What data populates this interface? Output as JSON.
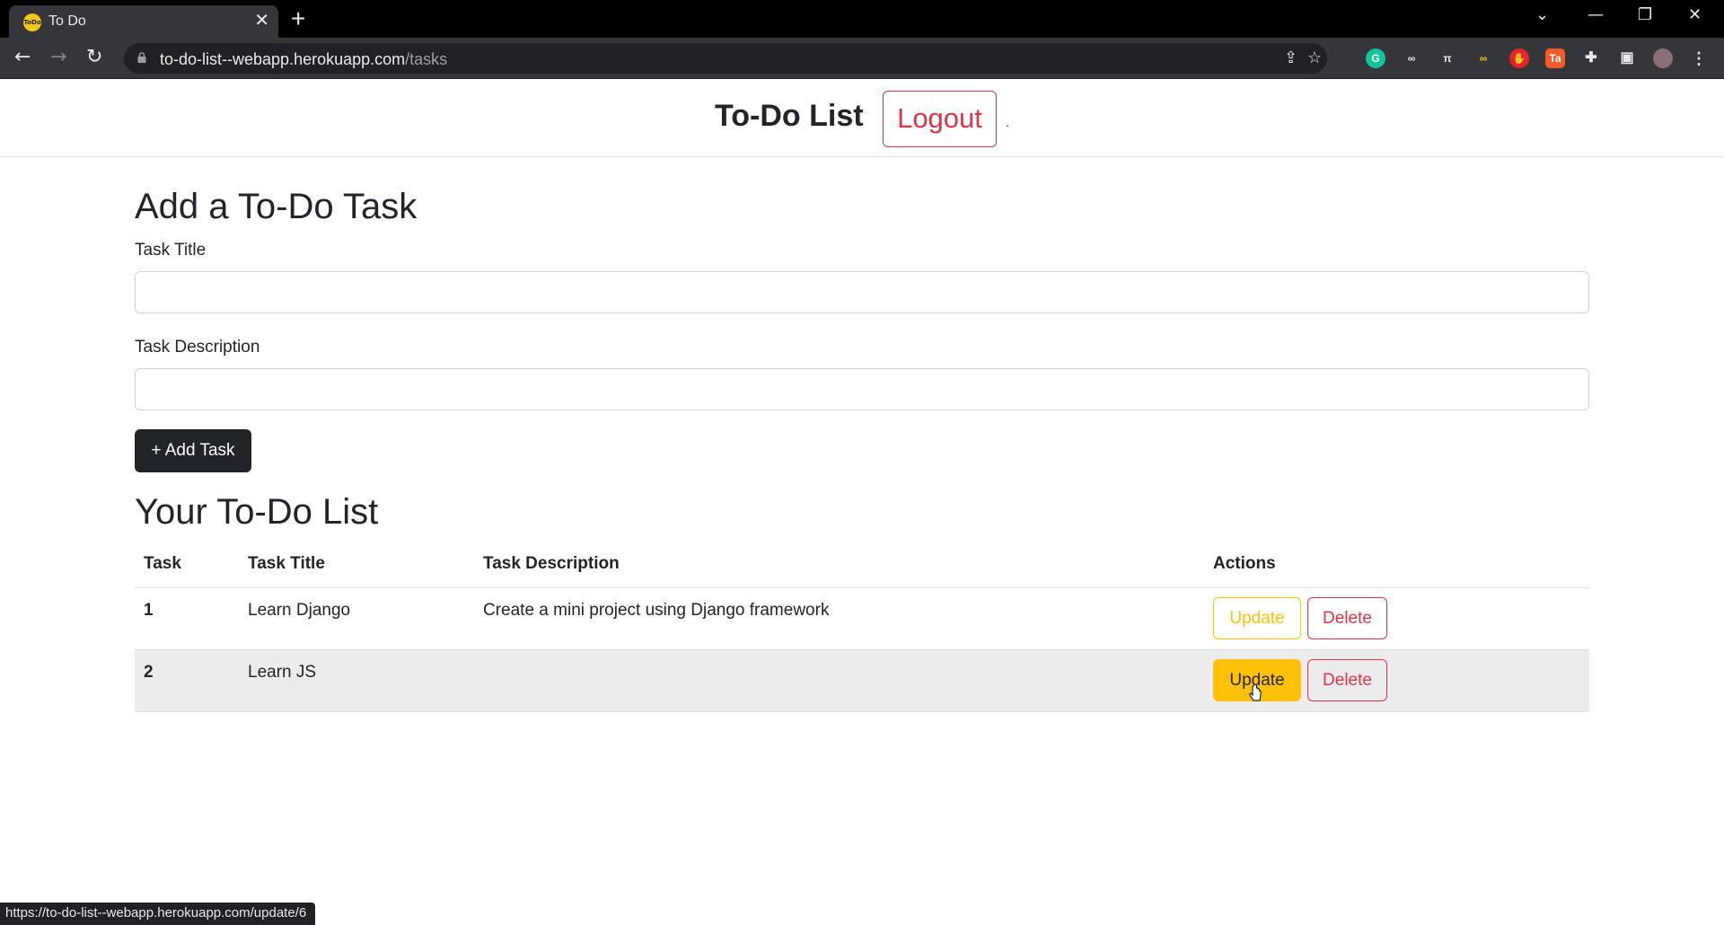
{
  "browser": {
    "tab_title": "To Do",
    "favicon_text": "ToDo",
    "url_host": "to-do-list--webapp.herokuapp.com",
    "url_path": "/tasks",
    "status_url": "https://to-do-list--webapp.herokuapp.com/update/6"
  },
  "header": {
    "brand": "To-Do List",
    "logout_label": "Logout",
    "dot": "."
  },
  "form": {
    "heading": "Add a To-Do Task",
    "title_label": "Task Title",
    "title_value": "",
    "description_label": "Task Description",
    "description_value": "",
    "add_button_label": "+ Add Task"
  },
  "list": {
    "heading": "Your To-Do List",
    "columns": [
      "Task",
      "Task Title",
      "Task Description",
      "Actions"
    ],
    "rows": [
      {
        "task": "1",
        "title": "Learn Django",
        "description": "Create a mini project using Django framework",
        "update_label": "Update",
        "delete_label": "Delete"
      },
      {
        "task": "2",
        "title": "Learn JS",
        "description": "",
        "update_label": "Update",
        "delete_label": "Delete"
      }
    ]
  },
  "colors": {
    "update": "#ffc107",
    "delete": "#dc3545",
    "dark": "#212529"
  }
}
